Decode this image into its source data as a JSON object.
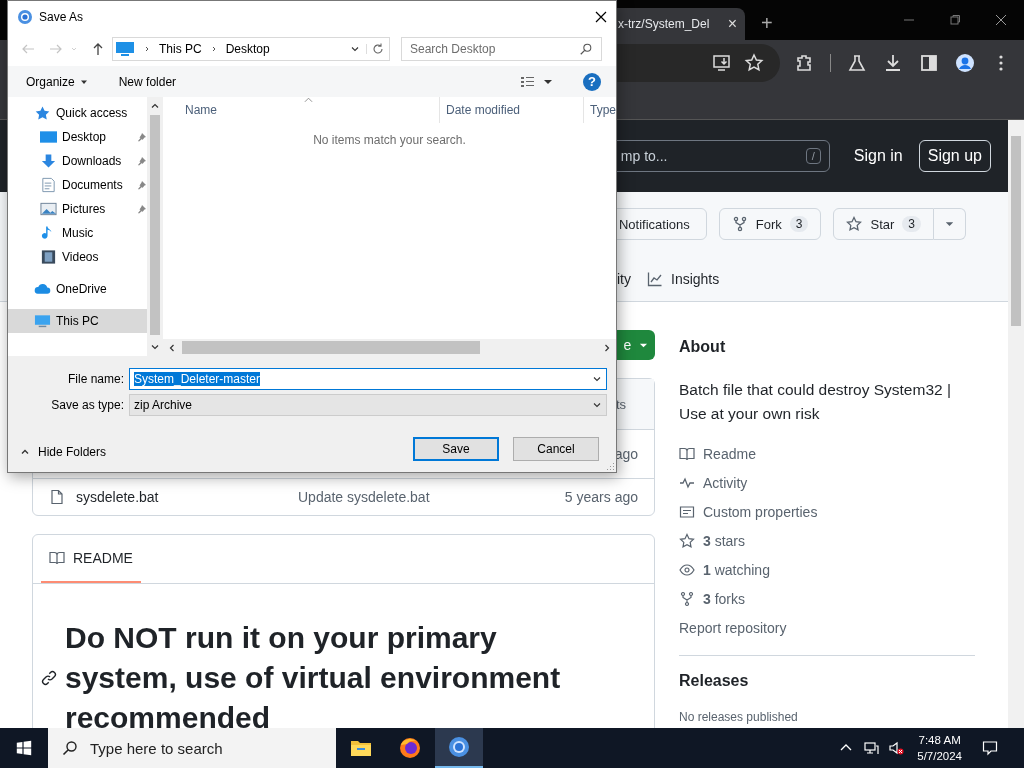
{
  "browser": {
    "tab": {
      "title": "x-trz/System_Del",
      "close": "×"
    },
    "new_tab": "+"
  },
  "github_header": {
    "search_placeholder": "mp to...",
    "search_key": "/",
    "sign_in": "Sign in",
    "sign_up": "Sign up"
  },
  "repo_actions": [
    {
      "kind": "notifications",
      "label": "Notifications"
    },
    {
      "kind": "fork",
      "label": "Fork",
      "count": "3"
    },
    {
      "kind": "star",
      "label": "Star",
      "count": "3"
    }
  ],
  "repo_tabs": [
    {
      "kind": "activity",
      "label": "ity",
      "selected": false
    },
    {
      "kind": "insights",
      "label": "Insights",
      "selected": false
    }
  ],
  "code_button": {
    "label": "e"
  },
  "file_list": {
    "header_fragment": "ts",
    "rows": [
      {
        "kind": "fragment",
        "age": "ago"
      },
      {
        "kind": "file",
        "name": "sysdelete.bat",
        "message": "Update sysdelete.bat",
        "age": "5 years ago"
      }
    ]
  },
  "readme": {
    "tab": "README",
    "heading": "Do NOT run it on your primary system, use of virtual environment recommended"
  },
  "about": {
    "title": "About",
    "description": "Batch file that could destroy System32 | Use at your own risk",
    "links": [
      {
        "kind": "book",
        "label": "Readme"
      },
      {
        "kind": "pulse",
        "label": "Activity"
      },
      {
        "kind": "note",
        "label": "Custom properties"
      },
      {
        "kind": "star",
        "label": "**3** stars"
      },
      {
        "kind": "eye",
        "label": "**1** watching"
      },
      {
        "kind": "fork",
        "label": "**3** forks"
      }
    ],
    "report": "Report repository"
  },
  "releases": {
    "title": "Releases",
    "empty": "No releases published"
  },
  "dialog": {
    "title": "Save As",
    "breadcrumb": [
      "This PC",
      "Desktop"
    ],
    "search_placeholder": "Search Desktop",
    "toolbar": {
      "organize": "Organize",
      "new_folder": "New folder"
    },
    "nav": [
      {
        "kind": "quick",
        "label": "Quick access",
        "selected": false,
        "children": [
          {
            "kind": "desktop",
            "label": "Desktop",
            "pinned": true,
            "selected": false
          },
          {
            "kind": "downloads",
            "label": "Downloads",
            "pinned": true,
            "selected": false
          },
          {
            "kind": "documents",
            "label": "Documents",
            "pinned": true,
            "selected": false
          },
          {
            "kind": "pictures",
            "label": "Pictures",
            "pinned": true,
            "selected": false
          },
          {
            "kind": "music",
            "label": "Music",
            "pinned": false,
            "selected": false
          },
          {
            "kind": "videos",
            "label": "Videos",
            "pinned": false,
            "selected": false
          }
        ]
      },
      {
        "kind": "cloud",
        "label": "OneDrive",
        "selected": false
      },
      {
        "kind": "pc",
        "label": "This PC",
        "selected": true
      }
    ],
    "columns": [
      "Name",
      "Date modified",
      "Type"
    ],
    "empty": "No items match your search.",
    "file_name": {
      "label": "File name:",
      "value": "System_Deleter-master",
      "value_selected": true
    },
    "save_as_type": {
      "label": "Save as type:",
      "value": "zip Archive"
    },
    "hide_folders": "Hide Folders",
    "help": "?",
    "buttons": [
      {
        "label": "Save",
        "default": true
      },
      {
        "label": "Cancel",
        "default": false
      }
    ]
  },
  "taskbar": {
    "search_placeholder": "Type here to search",
    "apps": [
      {
        "kind": "explorer",
        "selected": false
      },
      {
        "kind": "firefox",
        "selected": false
      },
      {
        "kind": "chrome",
        "selected": true
      }
    ],
    "volume_muted": true,
    "time": "7:48 AM",
    "date": "5/7/2024"
  }
}
